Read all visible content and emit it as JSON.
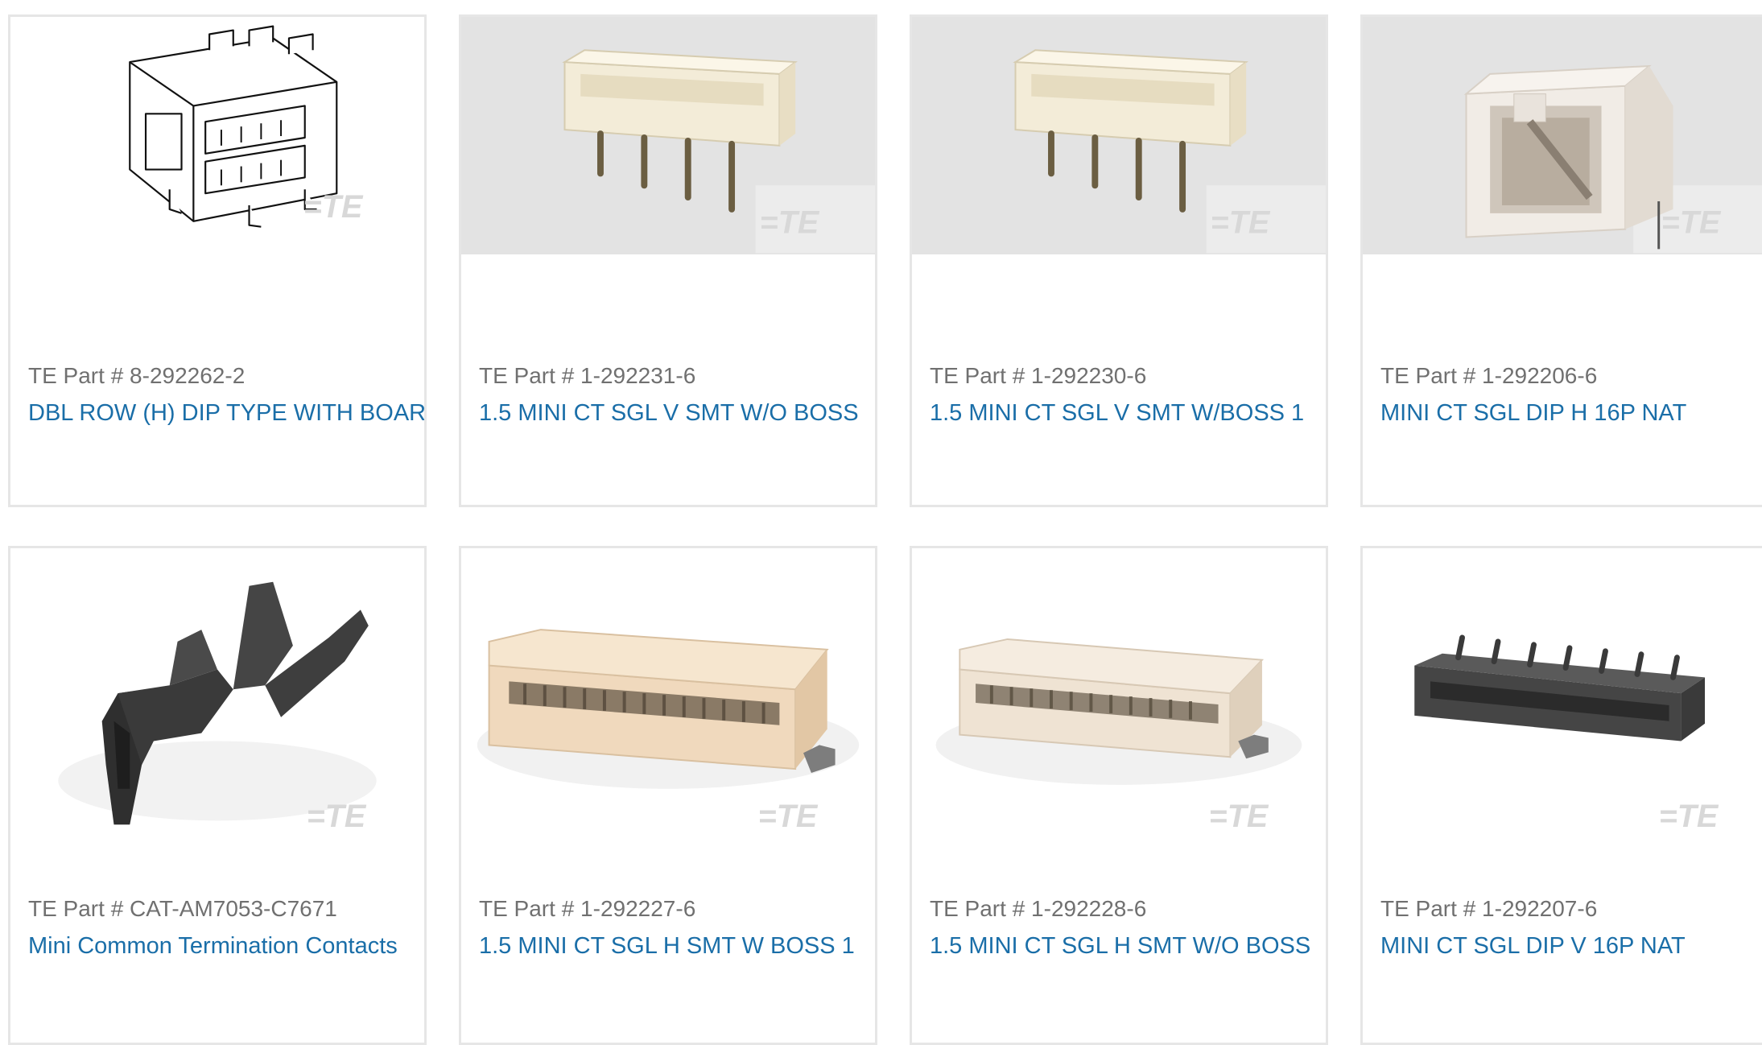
{
  "colors": {
    "border": "#e6e6e6",
    "part_number_text": "#707070",
    "link_text": "#1a6ea8",
    "image_placeholder_bg": "#e3e3e3"
  },
  "watermark": "TE",
  "products": [
    {
      "part_number": "TE Part # 8-292262-2",
      "description": "DBL ROW (H) DIP TYPE WITH BOAR",
      "image": "dbl-row-dip-header-drawing",
      "image_bg": "white"
    },
    {
      "part_number": "TE Part # 1-292231-6",
      "description": "1.5 MINI CT SGL V SMT W/O BOSS",
      "image": "vertical-smt-header-natural",
      "image_bg": "grey"
    },
    {
      "part_number": "TE Part # 1-292230-6",
      "description": "1.5 MINI CT SGL V SMT W/BOSS 1",
      "image": "vertical-smt-header-natural",
      "image_bg": "grey"
    },
    {
      "part_number": "TE Part # 1-292206-6",
      "description": "MINI CT SGL DIP H 16P NAT",
      "image": "right-angle-dip-header-natural",
      "image_bg": "grey"
    },
    {
      "part_number": "TE Part # CAT-AM7053-C7671",
      "description": "Mini Common Termination Contacts",
      "image": "crimp-contact-black",
      "image_bg": "white"
    },
    {
      "part_number": "TE Part # 1-292227-6",
      "description": "1.5 MINI CT SGL H SMT W BOSS 1",
      "image": "horizontal-smt-header-natural",
      "image_bg": "white"
    },
    {
      "part_number": "TE Part # 1-292228-6",
      "description": "1.5 MINI CT SGL H SMT W/O BOSS",
      "image": "horizontal-smt-header-natural",
      "image_bg": "white"
    },
    {
      "part_number": "TE Part # 1-292207-6",
      "description": "MINI CT SGL DIP V 16P NAT",
      "image": "vertical-dip-header-black",
      "image_bg": "white"
    }
  ]
}
